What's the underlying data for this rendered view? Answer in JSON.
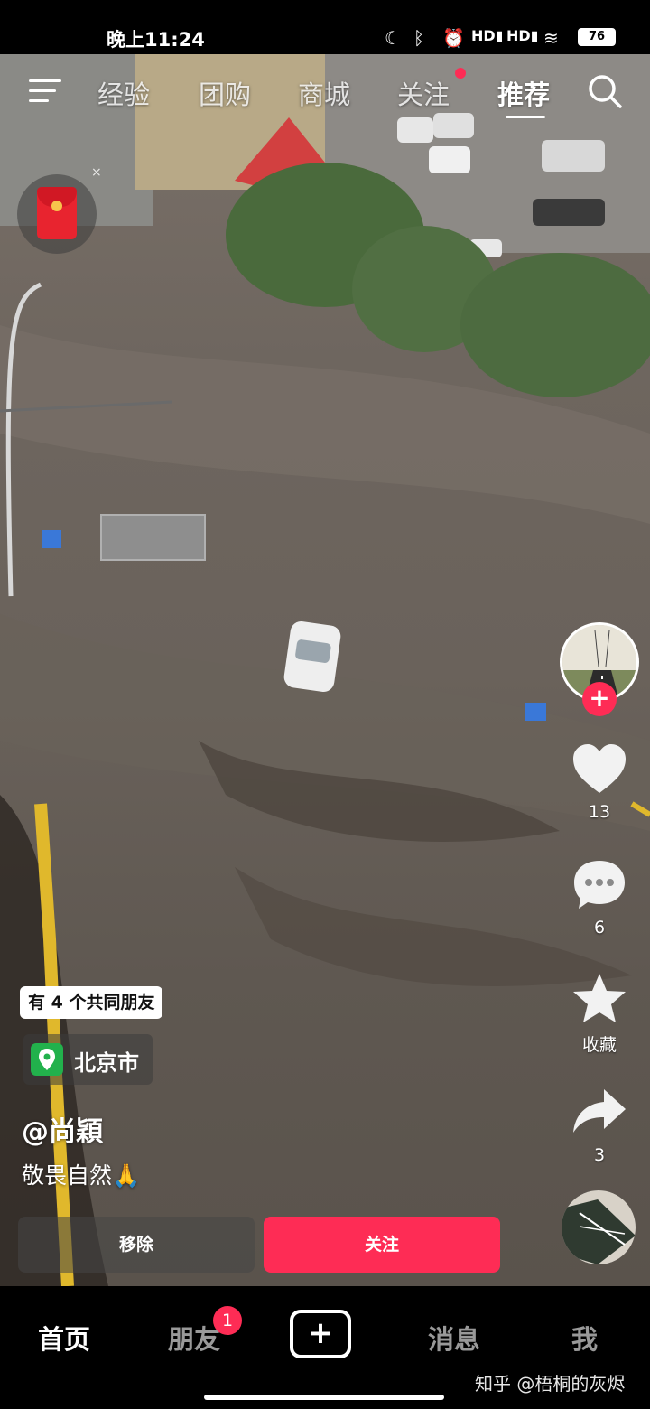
{
  "status_bar": {
    "time": "晚上11:24",
    "battery": "76",
    "icons": [
      "moon-icon",
      "bluetooth-icon",
      "alarm-icon",
      "hd-signal-icon",
      "hd-signal-icon-2",
      "wifi-icon",
      "battery-icon"
    ]
  },
  "top_nav": {
    "tabs": [
      {
        "label": "经验",
        "active": false
      },
      {
        "label": "团购",
        "active": false
      },
      {
        "label": "商城",
        "active": false
      },
      {
        "label": "关注",
        "active": false,
        "dot": true
      },
      {
        "label": "推荐",
        "active": true
      }
    ],
    "menu_icon": "menu-icon",
    "search_icon": "search-icon"
  },
  "red_packet": {
    "close_label": "×"
  },
  "actions": {
    "like_count": "13",
    "comment_count": "6",
    "favorite_label": "收藏",
    "share_count": "3",
    "follow_plus": "+"
  },
  "video_info": {
    "mutual_friends": "有 4 个共同朋友",
    "location": "北京市",
    "author": "@尚穎",
    "caption": "敬畏自然🙏"
  },
  "buttons": {
    "remove": "移除",
    "follow": "关注"
  },
  "bottom_nav": {
    "home": "首页",
    "friends": "朋友",
    "friends_badge": "1",
    "create": "+",
    "messages": "消息",
    "me": "我"
  },
  "watermark": "知乎 @梧桐的灰烬",
  "colors": {
    "accent": "#fe2c55",
    "location_green": "#22b14c"
  }
}
